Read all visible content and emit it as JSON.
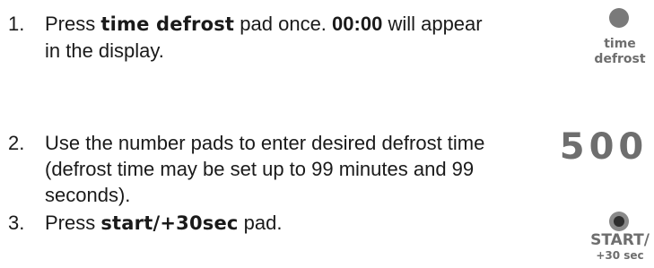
{
  "steps": [
    {
      "number": "1.",
      "prefix": "Press ",
      "keyword": "time defrost",
      "middle": " pad once. ",
      "bold": "00:00",
      "suffix": " will appear in the display."
    },
    {
      "number": "2.",
      "text": "Use the number pads to enter desired defrost time (defrost time may be set up to 99 minutes and 99 seconds)."
    },
    {
      "number": "3.",
      "prefix": "Press ",
      "keyword": "start/+30sec",
      "suffix": " pad."
    }
  ],
  "panel": {
    "time_defrost_line1": "time",
    "time_defrost_line2": "defrost",
    "display_value": "500",
    "start_line1": "START/",
    "start_line2": "+30 sec"
  },
  "colors": {
    "text": "#1a1a1a",
    "panel_gray": "#6e6e6e"
  }
}
